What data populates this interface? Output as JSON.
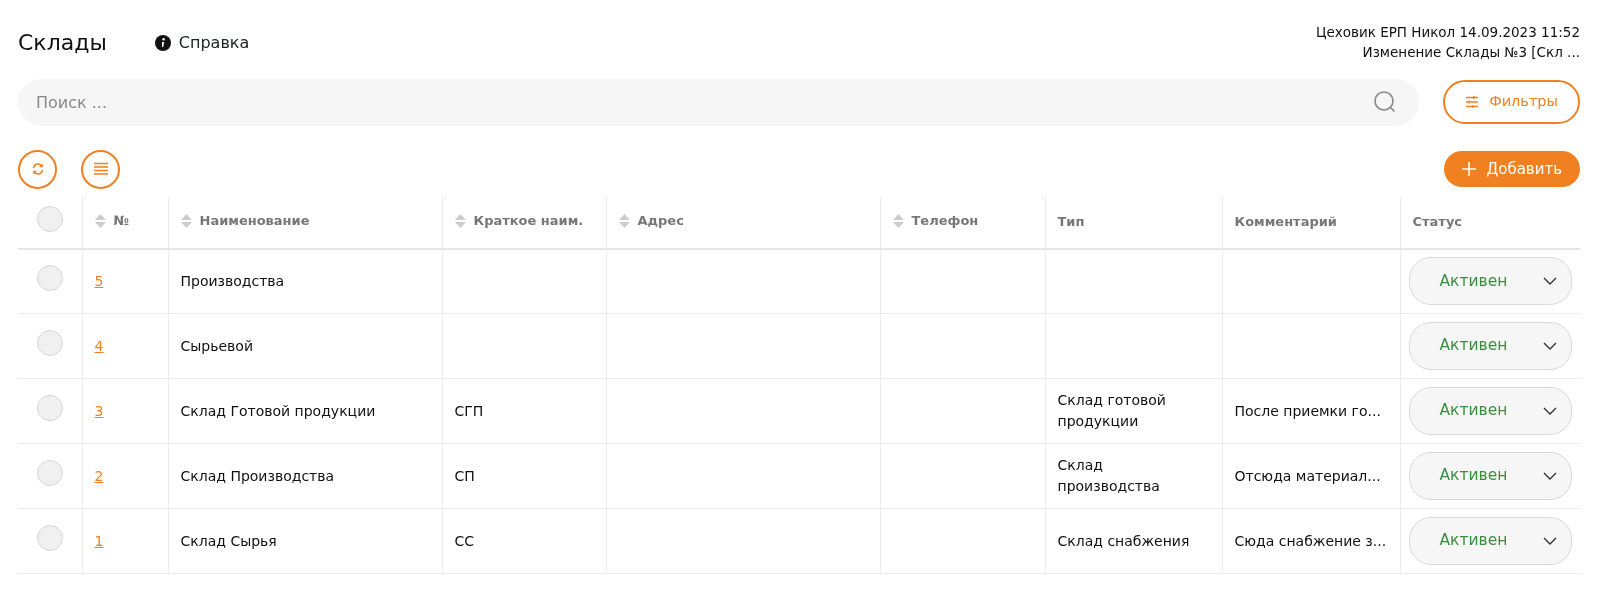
{
  "header": {
    "title": "Склады",
    "help": "Справка",
    "user_info": "Цеховик ЕРП Никол 14.09.2023 11:52",
    "last_action": "Изменение Склады №3 [Скл ..."
  },
  "search": {
    "placeholder": "Поиск ..."
  },
  "filters_button": "Фильтры",
  "add_button": "Добавить",
  "table": {
    "select_all_checked": false,
    "columns": [
      {
        "label": "№",
        "sortable": true
      },
      {
        "label": "Наименование",
        "sortable": true
      },
      {
        "label": "Краткое наим.",
        "sortable": true
      },
      {
        "label": "Адрес",
        "sortable": true
      },
      {
        "label": "Телефон",
        "sortable": true
      },
      {
        "label": "Тип",
        "sortable": false
      },
      {
        "label": "Комментарий",
        "sortable": false
      },
      {
        "label": "Статус",
        "sortable": false
      }
    ],
    "rows": [
      {
        "checked": false,
        "number": "5",
        "name": "Производства",
        "short_name": "",
        "address": "",
        "phone": "",
        "type": "",
        "comment": "",
        "status": "Активен"
      },
      {
        "checked": false,
        "number": "4",
        "name": "Сырьевой",
        "short_name": "",
        "address": "",
        "phone": "",
        "type": "",
        "comment": "",
        "status": "Активен"
      },
      {
        "checked": false,
        "number": "3",
        "name": "Склад Готовой продукции",
        "short_name": "СГП",
        "address": "",
        "phone": "",
        "type": "Склад готовой продукции",
        "comment": "После приемки го...",
        "status": "Активен"
      },
      {
        "checked": false,
        "number": "2",
        "name": "Склад Производства",
        "short_name": "СП",
        "address": "",
        "phone": "",
        "type": "Склад производства",
        "comment": "Отсюда материал...",
        "status": "Активен"
      },
      {
        "checked": false,
        "number": "1",
        "name": "Склад Сырья",
        "short_name": "СС",
        "address": "",
        "phone": "",
        "type": "Склад снабжения",
        "comment": "Сюда снабжение з...",
        "status": "Активен"
      }
    ]
  }
}
